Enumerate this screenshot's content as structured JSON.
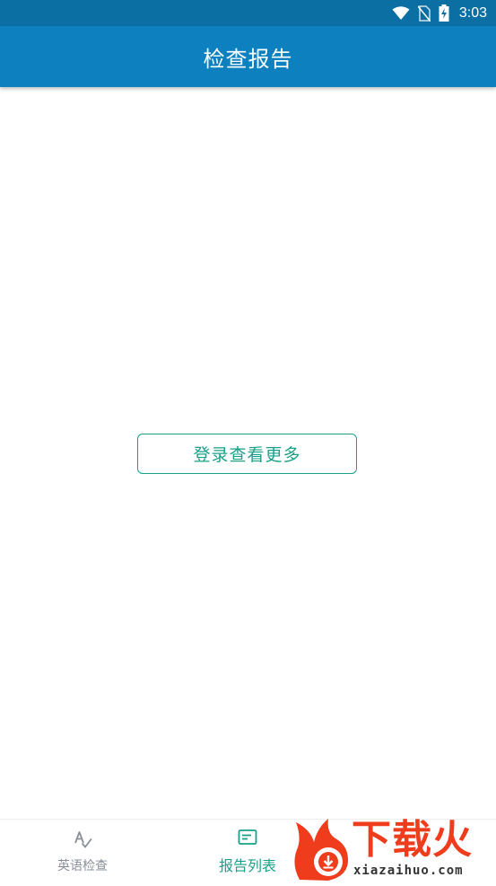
{
  "status_bar": {
    "time": "3:03",
    "icons": [
      "wifi-icon",
      "no-sim-icon",
      "battery-charging-icon"
    ]
  },
  "app_bar": {
    "title": "检查报告"
  },
  "main": {
    "login_button_label": "登录查看更多"
  },
  "bottom_nav": {
    "items": [
      {
        "label": "英语检查",
        "icon": "spell-check-icon",
        "active": false
      },
      {
        "label": "报告列表",
        "icon": "report-list-icon",
        "active": true
      }
    ]
  },
  "watermark": {
    "title": "下载火",
    "url": "xiazaihuo.com"
  },
  "colors": {
    "status_bar": "#0b6fa4",
    "app_bar": "#0d80bf",
    "accent": "#1aa08a",
    "inactive": "#8a8f98",
    "watermark": "#ef3c1d"
  }
}
